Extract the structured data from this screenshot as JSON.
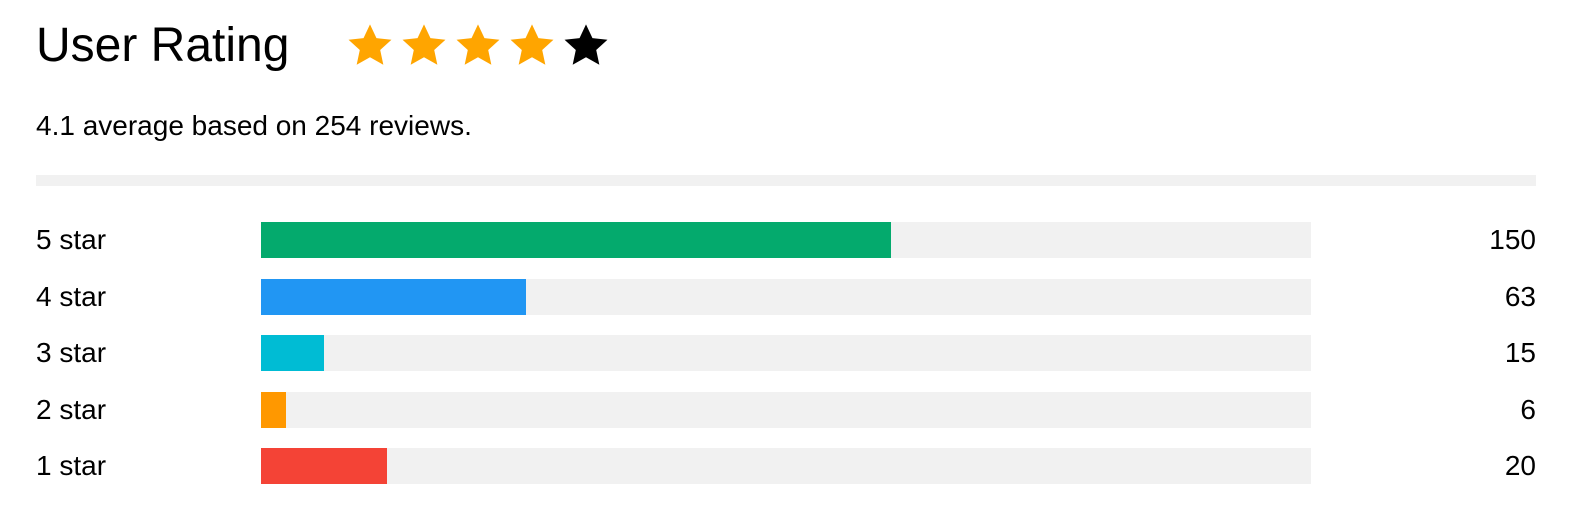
{
  "header": {
    "title": "User Rating",
    "stars": [
      {
        "icon": "star-icon",
        "filled": true,
        "color": "#ffa500"
      },
      {
        "icon": "star-icon",
        "filled": true,
        "color": "#ffa500"
      },
      {
        "icon": "star-icon",
        "filled": true,
        "color": "#ffa500"
      },
      {
        "icon": "star-icon",
        "filled": true,
        "color": "#ffa500"
      },
      {
        "icon": "star-icon",
        "filled": false,
        "color": "#000000"
      }
    ],
    "stars_filled": 4,
    "stars_total": 5
  },
  "summary": "4.1 average based on 254 reviews.",
  "breakdown": {
    "max_value": 250,
    "track_color": "#f1f1f1",
    "rows": [
      {
        "label": "5 star",
        "count": "150",
        "value": 150,
        "color": "#04aa6d"
      },
      {
        "label": "4 star",
        "count": "63",
        "value": 63,
        "color": "#2196f3"
      },
      {
        "label": "3 star",
        "count": "15",
        "value": 15,
        "color": "#00bcd4"
      },
      {
        "label": "2 star",
        "count": "6",
        "value": 6,
        "color": "#ff9800"
      },
      {
        "label": "1 star",
        "count": "20",
        "value": 30,
        "color": "#f44336"
      }
    ]
  }
}
